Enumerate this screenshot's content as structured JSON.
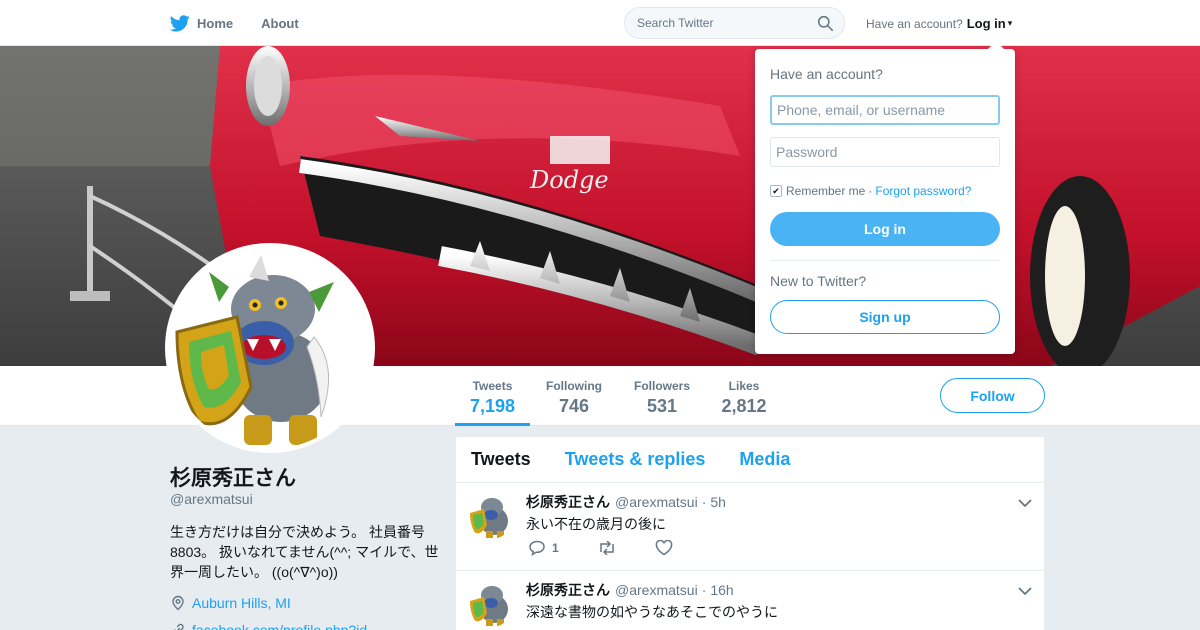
{
  "nav": {
    "home_label": "Home",
    "about_label": "About",
    "search_placeholder": "Search Twitter",
    "have_account": "Have an account?",
    "login_label": "Log in",
    "caret": "▾"
  },
  "profile": {
    "name": "杉原秀正さん",
    "handle": "@arexmatsui",
    "bio": "生き方だけは自分で決めよう。 社員番号8803。 扱いなれてません(^^; マイルで、世界一周したい。 ((o(^∇^)o))",
    "location": "Auburn Hills, MI",
    "url": "facebook.com/profile.php?id..."
  },
  "stats": [
    {
      "label": "Tweets",
      "value": "7,198"
    },
    {
      "label": "Following",
      "value": "746"
    },
    {
      "label": "Followers",
      "value": "531"
    },
    {
      "label": "Likes",
      "value": "2,812"
    }
  ],
  "follow_label": "Follow",
  "timeline": {
    "tabs": [
      "Tweets",
      "Tweets & replies",
      "Media"
    ],
    "tweets": [
      {
        "name": "杉原秀正さん",
        "handle": "@arexmatsui",
        "time": "5h",
        "text": "永い不在の歳月の後に",
        "replies": "1"
      },
      {
        "name": "杉原秀正さん",
        "handle": "@arexmatsui",
        "time": "16h",
        "text": "深遠な書物の如やうなあそこでのやうに",
        "replies": ""
      }
    ]
  },
  "login_dropdown": {
    "title": "Have an account?",
    "username_placeholder": "Phone, email, or username",
    "password_placeholder": "Password",
    "remember_label": "Remember me",
    "separator": "·",
    "forgot_label": "Forgot password?",
    "login_button": "Log in",
    "new_to": "New to Twitter?",
    "signup_button": "Sign up"
  },
  "colors": {
    "accent": "#1da1f2",
    "login_button": "#4ab3f4",
    "background": "#e6ecf0"
  }
}
